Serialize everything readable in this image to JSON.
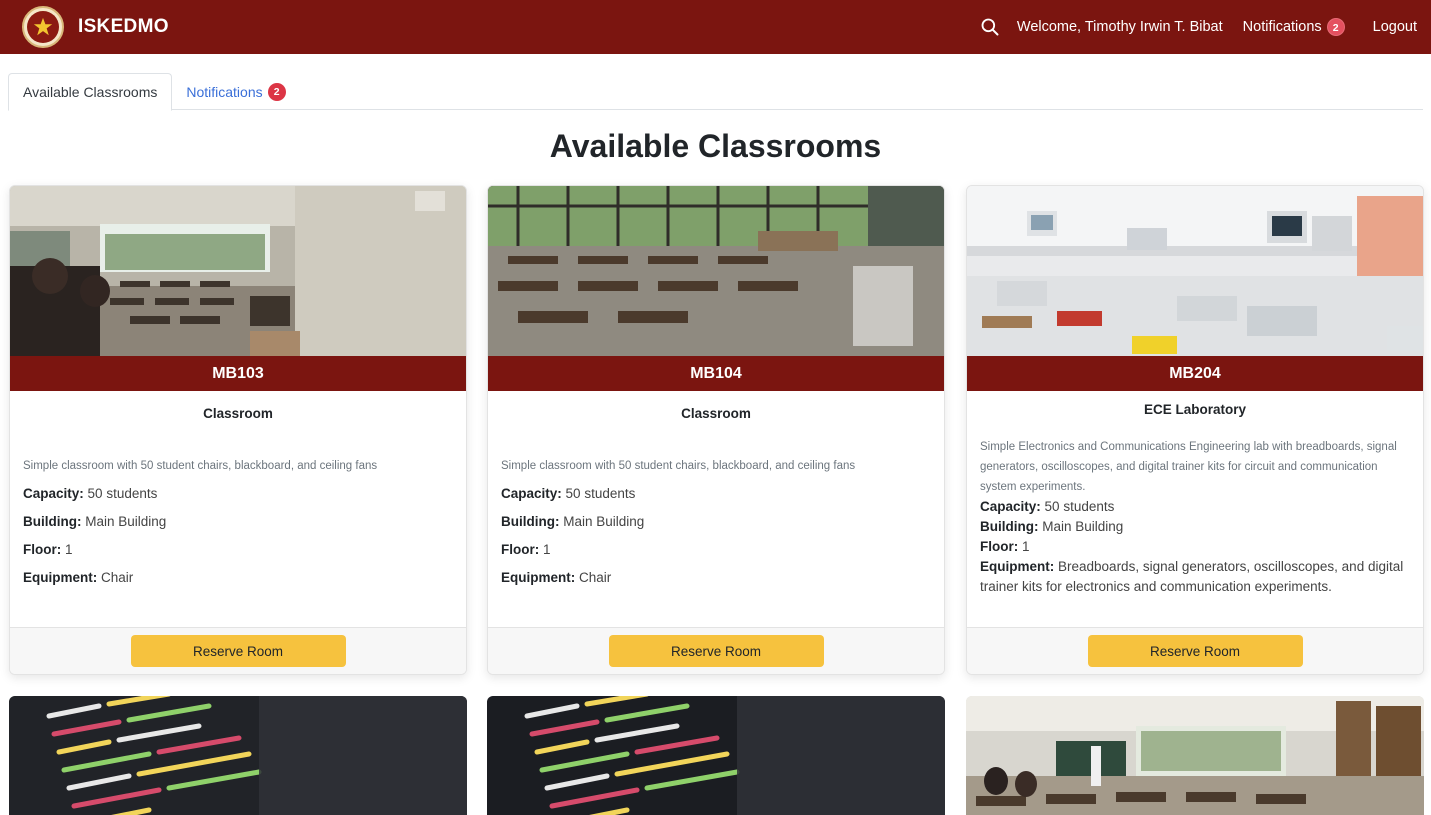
{
  "app": {
    "brand": "ISKEDMO",
    "welcome": "Welcome, Timothy Irwin T. Bibat",
    "notifications_label": "Notifications",
    "notifications_count": "2",
    "logout_label": "Logout"
  },
  "tabs": [
    {
      "label": "Available Classrooms",
      "active": true
    },
    {
      "label": "Notifications",
      "badge": "2",
      "active": false
    }
  ],
  "page_title": "Available Classrooms",
  "rooms": [
    {
      "name": "MB103",
      "type": "Classroom",
      "description": "Simple classroom with 50 student chairs, blackboard, and ceiling fans",
      "capacity_label": "Capacity:",
      "capacity": "50 students",
      "building_label": "Building:",
      "building": "Main Building",
      "floor_label": "Floor:",
      "floor": "1",
      "equipment_label": "Equipment:",
      "equipment": "Chair",
      "button": "Reserve Room"
    },
    {
      "name": "MB104",
      "type": "Classroom",
      "description": "Simple classroom with 50 student chairs, blackboard, and ceiling fans",
      "capacity_label": "Capacity:",
      "capacity": "50 students",
      "building_label": "Building:",
      "building": "Main Building",
      "floor_label": "Floor:",
      "floor": "1",
      "equipment_label": "Equipment:",
      "equipment": "Chair",
      "button": "Reserve Room"
    },
    {
      "name": "MB204",
      "type": "ECE Laboratory",
      "description": "Simple Electronics and Communications Engineering lab with breadboards, signal generators, oscilloscopes, and digital trainer kits for circuit and communication system experiments.",
      "capacity_label": "Capacity:",
      "capacity": "50 students",
      "building_label": "Building:",
      "building": "Main Building",
      "floor_label": "Floor:",
      "floor": "1",
      "equipment_label": "Equipment:",
      "equipment": "Breadboards, signal generators, oscilloscopes, and digital trainer kits for electronics and communication experiments.",
      "button": "Reserve Room"
    }
  ],
  "colors": {
    "primary": "#7b1510",
    "button": "#f6c23e",
    "badge": "#dc3545",
    "link": "#3a6fd8"
  },
  "icons": [
    "seal-logo-icon",
    "search-icon"
  ]
}
